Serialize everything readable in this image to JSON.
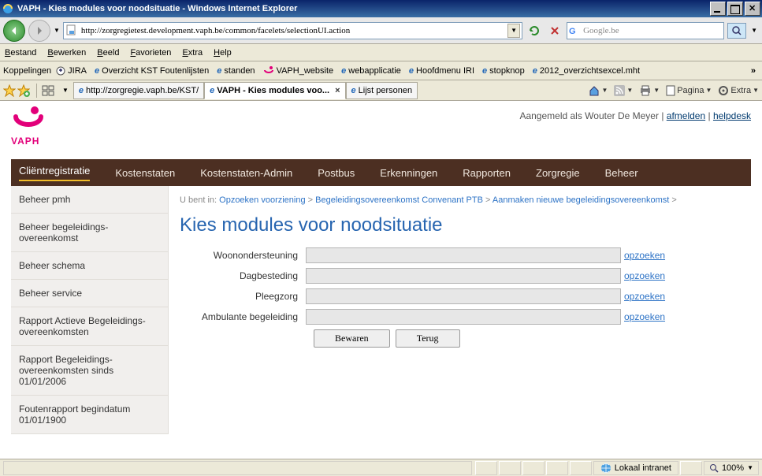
{
  "window": {
    "title": "VAPH - Kies modules voor noodsituatie - Windows Internet Explorer"
  },
  "address": {
    "url": "http://zorgregietest.development.vaph.be/common/facelets/selectionUI.action"
  },
  "search": {
    "placeholder": "Google.be"
  },
  "menus": [
    "Bestand",
    "Bewerken",
    "Beeld",
    "Favorieten",
    "Extra",
    "Help"
  ],
  "links_label": "Koppelingen",
  "links": [
    {
      "label": "JIRA",
      "icon": "jira"
    },
    {
      "label": "Overzicht KST Foutenlijsten",
      "icon": "ie"
    },
    {
      "label": "standen",
      "icon": "ie"
    },
    {
      "label": "VAPH_website",
      "icon": "vaph"
    },
    {
      "label": "webapplicatie",
      "icon": "ie"
    },
    {
      "label": "Hoofdmenu IRI",
      "icon": "ie"
    },
    {
      "label": "stopknop",
      "icon": "ie"
    },
    {
      "label": "2012_overzichtsexcel.mht",
      "icon": "ie"
    }
  ],
  "tabs": [
    {
      "label": "http://zorgregie.vaph.be/KST/",
      "active": false,
      "closable": false
    },
    {
      "label": "VAPH - Kies modules voo...",
      "active": true,
      "closable": true
    },
    {
      "label": "Lijst personen",
      "active": false,
      "closable": false
    }
  ],
  "toolbar": {
    "page_label": "Pagina",
    "extra_label": "Extra"
  },
  "header": {
    "brand": "VAPH",
    "login_prefix": "Aangemeld als ",
    "user": "Wouter De Meyer",
    "sep": " | ",
    "logout": "afmelden",
    "helpdesk": "helpdesk"
  },
  "nav": [
    "Cliëntregistratie",
    "Kostenstaten",
    "Kostenstaten-Admin",
    "Postbus",
    "Erkenningen",
    "Rapporten",
    "Zorgregie",
    "Beheer"
  ],
  "nav_active_index": 0,
  "sidebar": [
    "Beheer pmh",
    "Beheer begeleidings-overeenkomst",
    "Beheer schema",
    "Beheer service",
    "Rapport Actieve Begeleidings-overeenkomsten",
    "Rapport Begeleidings-overeenkomsten sinds 01/01/2006",
    "Foutenrapport begindatum 01/01/1900"
  ],
  "breadcrumb": {
    "prefix": "U bent in: ",
    "parts": [
      "Opzoeken voorziening",
      "Begeleidingsovereenkomst Convenant PTB",
      "Aanmaken nieuwe begeleidingsovereenkomst"
    ],
    "sep": " > "
  },
  "page_title": "Kies modules voor noodsituatie",
  "form": {
    "rows": [
      {
        "label": "Woonondersteuning",
        "value": ""
      },
      {
        "label": "Dagbesteding",
        "value": ""
      },
      {
        "label": "Pleegzorg",
        "value": ""
      },
      {
        "label": "Ambulante begeleiding",
        "value": ""
      }
    ],
    "lookup_label": "opzoeken",
    "save": "Bewaren",
    "back": "Terug"
  },
  "status": {
    "zone": "Lokaal intranet",
    "zoom": "100%"
  }
}
